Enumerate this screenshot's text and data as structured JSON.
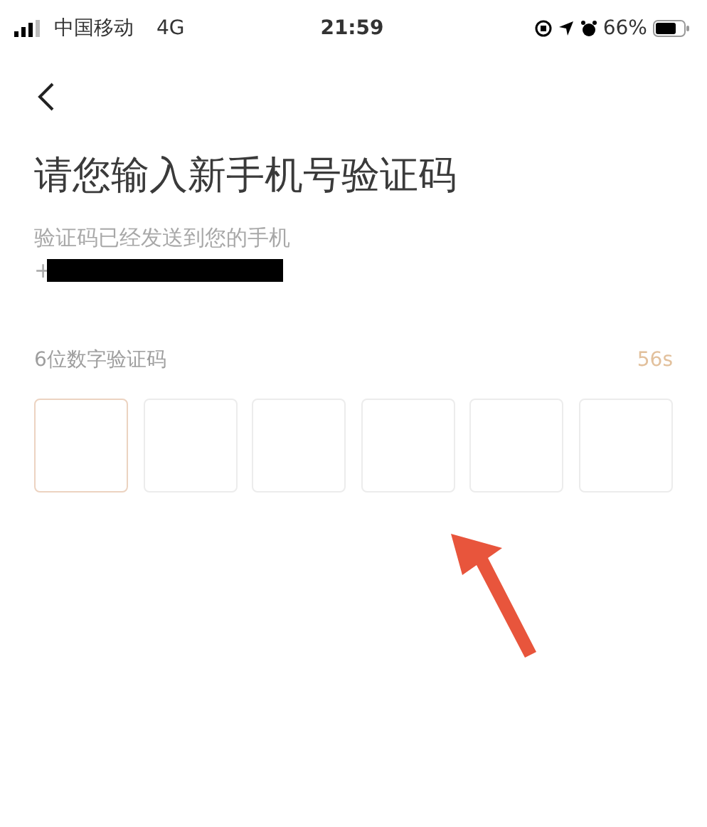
{
  "status_bar": {
    "carrier": "中国移动",
    "network": "4G",
    "time": "21:59",
    "battery": "66%"
  },
  "title": "请您输入新手机号验证码",
  "subtitle": "验证码已经发送到您的手机",
  "phone_prefix": "+",
  "code_label": "6位数字验证码",
  "countdown": "56s",
  "code_boxes": [
    {
      "focused": true
    },
    {
      "focused": false
    },
    {
      "focused": false
    },
    {
      "focused": false
    },
    {
      "focused": false
    },
    {
      "focused": false
    }
  ]
}
